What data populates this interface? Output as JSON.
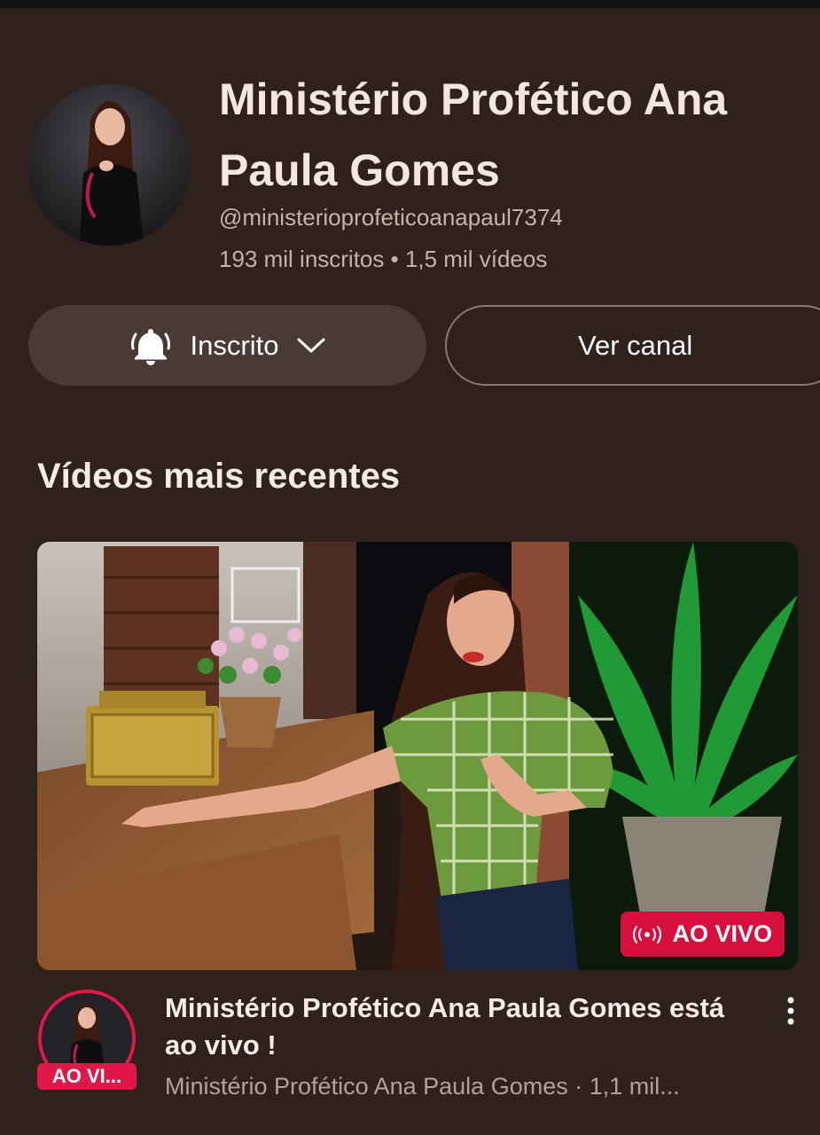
{
  "channel": {
    "name": "Ministério Profético Ana Paula Gomes",
    "handle": "@ministerioprofeticoanapaul7374",
    "stats": "193 mil inscritos • 1,5 mil vídeos"
  },
  "actions": {
    "subscribed_label": "Inscrito",
    "view_channel_label": "Ver canal"
  },
  "section": {
    "title": "Vídeos mais recentes"
  },
  "video": {
    "title": "Ministério Profético Ana Paula Gomes está ao vivo !",
    "meta": "Ministério Profético Ana Paula Gomes · 1,1 mil...",
    "live_badge": "AO VIVO",
    "avatar_live_label": "AO VI..."
  },
  "icons": {
    "subscribe": "bell-icon",
    "dropdown": "chevron-down-icon",
    "live": "live-broadcast-icon",
    "more": "more-vertical-icon"
  },
  "colors": {
    "background": "#2f211b",
    "live_red": "#d70f3c"
  }
}
